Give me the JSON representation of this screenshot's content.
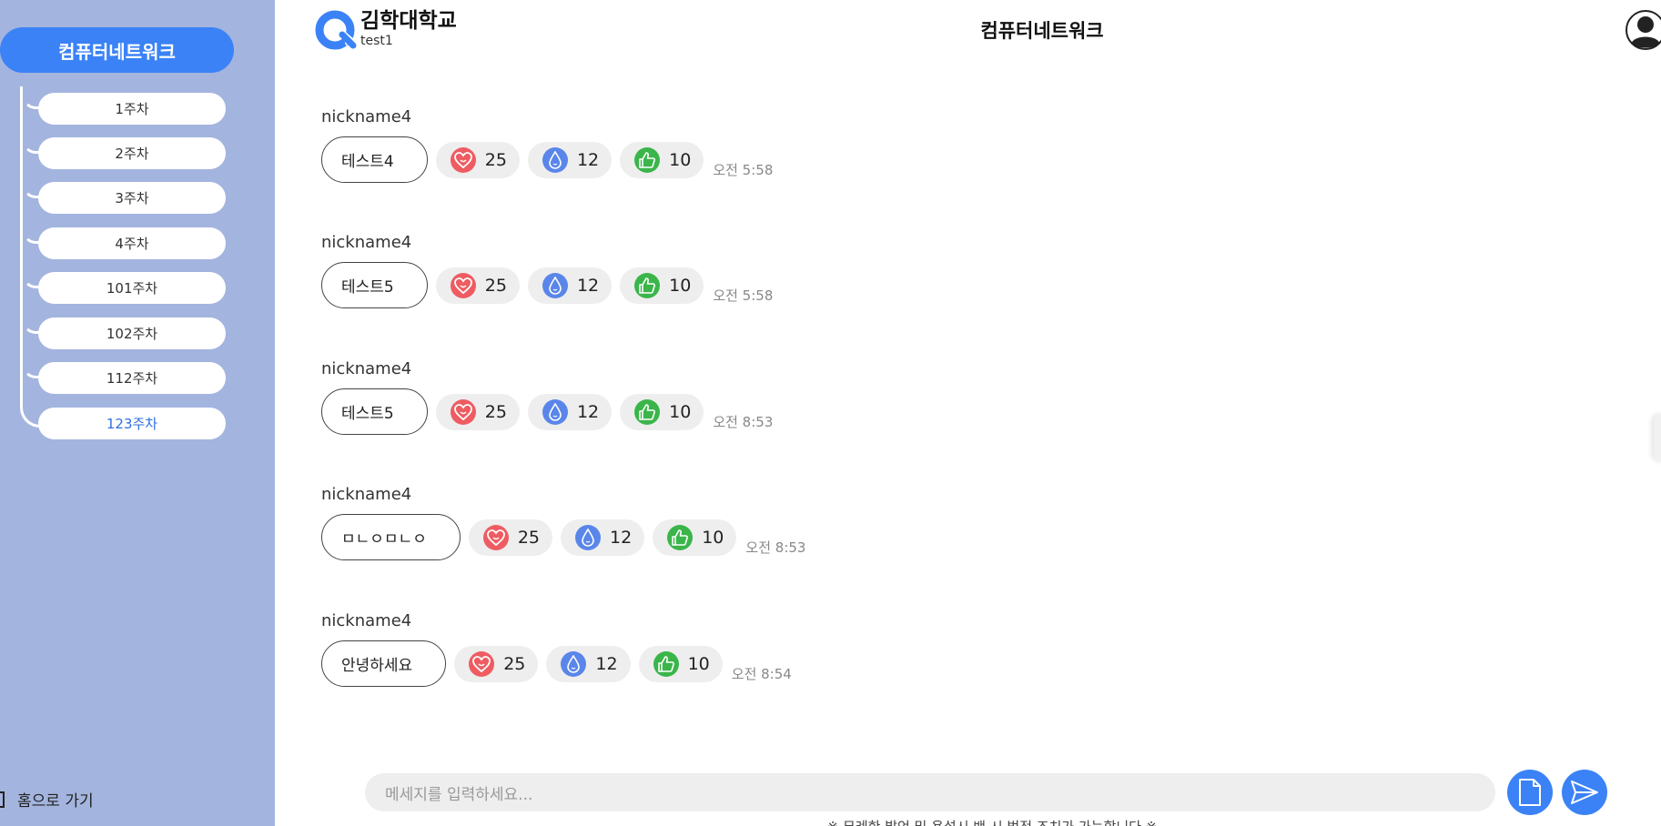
{
  "sidebar": {
    "course_label": "컴퓨터네트워크",
    "weeks": [
      {
        "label": "1주차"
      },
      {
        "label": "2주차"
      },
      {
        "label": "3주차"
      },
      {
        "label": "4주차"
      },
      {
        "label": "101주차"
      },
      {
        "label": "102주차"
      },
      {
        "label": "112주차"
      },
      {
        "label": "123주차"
      }
    ],
    "active_week": "123주차",
    "home_label": "홈으로 가기"
  },
  "header": {
    "brand": "김학대학교",
    "user": "test1",
    "title": "컴퓨터네트워크",
    "avatar_icon": "user-avatar-icon"
  },
  "messages": [
    {
      "nickname": "nickname4",
      "text": "테스트4",
      "reactions": {
        "heart": "25",
        "drop": "12",
        "like": "10"
      },
      "time": "오전 5:58"
    },
    {
      "nickname": "nickname4",
      "text": "테스트5",
      "reactions": {
        "heart": "25",
        "drop": "12",
        "like": "10"
      },
      "time": "오전 5:58"
    },
    {
      "nickname": "nickname4",
      "text": "테스트5",
      "reactions": {
        "heart": "25",
        "drop": "12",
        "like": "10"
      },
      "time": "오전 8:53"
    },
    {
      "nickname": "nickname4",
      "text": "ㅁㄴㅇㅁㄴㅇ",
      "reactions": {
        "heart": "25",
        "drop": "12",
        "like": "10"
      },
      "time": "오전 8:53"
    },
    {
      "nickname": "nickname4",
      "text": "안녕하세요",
      "reactions": {
        "heart": "25",
        "drop": "12",
        "like": "10"
      },
      "time": "오전 8:54"
    }
  ],
  "composer": {
    "placeholder": "메세지를 입력하세요...",
    "file_icon": "file-icon",
    "send_icon": "send-icon"
  },
  "footer_note": "※ 무례한 발언 및 욕설시 밴 시 법적 조치가 가능합니다 ※",
  "colors": {
    "sidebar_bg": "#a3b4df",
    "accent": "#3b82f6",
    "active_week_text": "#2f6fe0",
    "heart": "#ee5c62",
    "drop": "#5a86ea",
    "like": "#3bb54a"
  }
}
